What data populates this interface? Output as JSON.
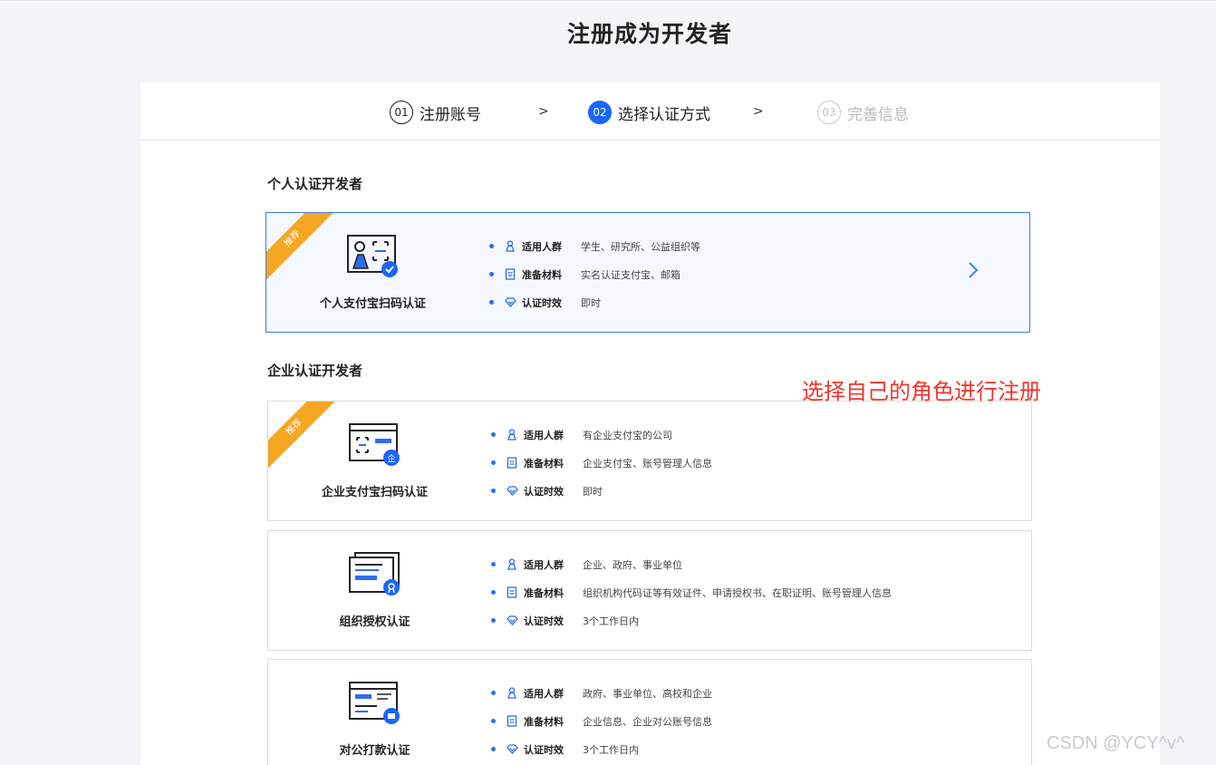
{
  "page": {
    "title": "注册成为开发者"
  },
  "steps": [
    {
      "num": "01",
      "label": "注册账号"
    },
    {
      "num": "02",
      "label": "选择认证方式"
    },
    {
      "num": "03",
      "label": "完善信息"
    }
  ],
  "step_separator": ">",
  "sections": {
    "personal": "个人认证开发者",
    "enterprise": "企业认证开发者"
  },
  "field_labels": {
    "audience": "适用人群",
    "materials": "准备材料",
    "timing": "认证时效"
  },
  "ribbon_text": "推荐",
  "cards": [
    {
      "name": "个人支付宝扫码认证",
      "audience": "学生、研究所、公益组织等",
      "materials": "实名认证支付宝、邮箱",
      "timing": "即时"
    },
    {
      "name": "企业支付宝扫码认证",
      "audience": "有企业支付宝的公司",
      "materials": "企业支付宝、账号管理人信息",
      "timing": "即时"
    },
    {
      "name": "组织授权认证",
      "audience": "企业、政府、事业单位",
      "materials": "组织机构代码证等有效证件、申请授权书、在职证明、账号管理人信息",
      "timing": "3个工作日内"
    },
    {
      "name": "对公打款认证",
      "audience": "政府、事业单位、高校和企业",
      "materials": "企业信息、企业对公账号信息",
      "timing": "3个工作日内"
    }
  ],
  "annotation": "选择自己的角色进行注册",
  "watermark": "CSDN @YCY^v^",
  "colors": {
    "accent": "#1a66ff",
    "ribbon": "#f5a623",
    "annotation": "#f0342b"
  }
}
